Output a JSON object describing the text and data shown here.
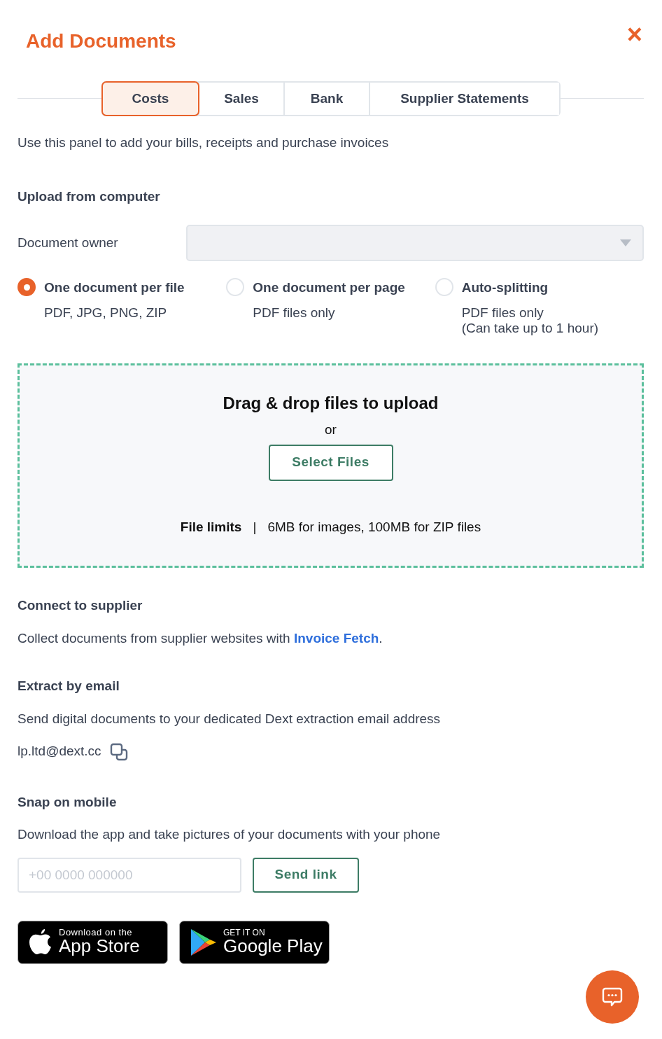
{
  "title": "Add Documents",
  "close": "×",
  "tabs": [
    {
      "label": "Costs",
      "selected": true
    },
    {
      "label": "Sales",
      "selected": false
    },
    {
      "label": "Bank",
      "selected": false
    },
    {
      "label": "Supplier Statements",
      "selected": false
    }
  ],
  "intro": "Use this panel to add your bills, receipts and purchase invoices",
  "upload": {
    "heading": "Upload from computer",
    "owner_label": "Document owner",
    "options": [
      {
        "label": "One document per file",
        "lines": [
          "PDF, JPG, PNG, ZIP"
        ],
        "selected": true
      },
      {
        "label": "One document per page",
        "lines": [
          "PDF files only"
        ],
        "selected": false
      },
      {
        "label": "Auto-splitting",
        "lines": [
          "PDF files only",
          "(Can take up to 1 hour)"
        ],
        "selected": false
      }
    ],
    "dropzone": {
      "heading": "Drag & drop files to upload",
      "or": "or",
      "button": "Select Files",
      "limits_label": "File limits",
      "separator": "|",
      "limits": "6MB for images, 100MB for ZIP files"
    }
  },
  "supplier": {
    "heading": "Connect to supplier",
    "text": "Collect documents from supplier websites with ",
    "link": "Invoice Fetch",
    "after": "."
  },
  "email": {
    "heading": "Extract by email",
    "text": "Send digital documents to your dedicated Dext extraction email address",
    "address": "lp.ltd@dext.cc"
  },
  "mobile": {
    "heading": "Snap on mobile",
    "text": "Download the app and take pictures of your documents with your phone",
    "phone_placeholder": "+00 0000 000000",
    "button": "Send link",
    "badges": [
      {
        "kind": "apple",
        "small": "Download on the",
        "big": "App Store"
      },
      {
        "kind": "google",
        "small": "GET IT ON",
        "big": "Google Play"
      }
    ]
  }
}
